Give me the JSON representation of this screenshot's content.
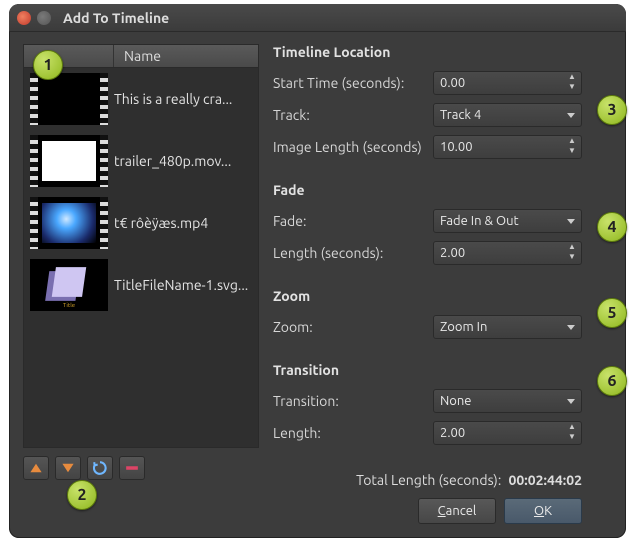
{
  "window": {
    "title": "Add To Timeline"
  },
  "list": {
    "header": "Name",
    "items": [
      {
        "label": "This is a really cra..."
      },
      {
        "label": "trailer_480p.mov..."
      },
      {
        "label": "t€ rôèÿæs.mp4"
      },
      {
        "label": "TitleFileName-1.svg..."
      }
    ]
  },
  "sections": {
    "location": {
      "title": "Timeline Location",
      "start_label": "Start Time (seconds):",
      "start_value": "0.00",
      "track_label": "Track:",
      "track_value": "Track 4",
      "imglen_label": "Image Length (seconds)",
      "imglen_value": "10.00"
    },
    "fade": {
      "title": "Fade",
      "fade_label": "Fade:",
      "fade_value": "Fade In & Out",
      "len_label": "Length (seconds):",
      "len_value": "2.00"
    },
    "zoom": {
      "title": "Zoom",
      "zoom_label": "Zoom:",
      "zoom_value": "Zoom In"
    },
    "transition": {
      "title": "Transition",
      "trans_label": "Transition:",
      "trans_value": "None",
      "len_label": "Length:",
      "len_value": "2.00"
    }
  },
  "footer": {
    "total_label": "Total Length (seconds):",
    "total_value": "00:02:44:02",
    "cancel": "Cancel",
    "ok": "OK"
  },
  "callouts": {
    "c1": "1",
    "c2": "2",
    "c3": "3",
    "c4": "4",
    "c5": "5",
    "c6": "6"
  }
}
